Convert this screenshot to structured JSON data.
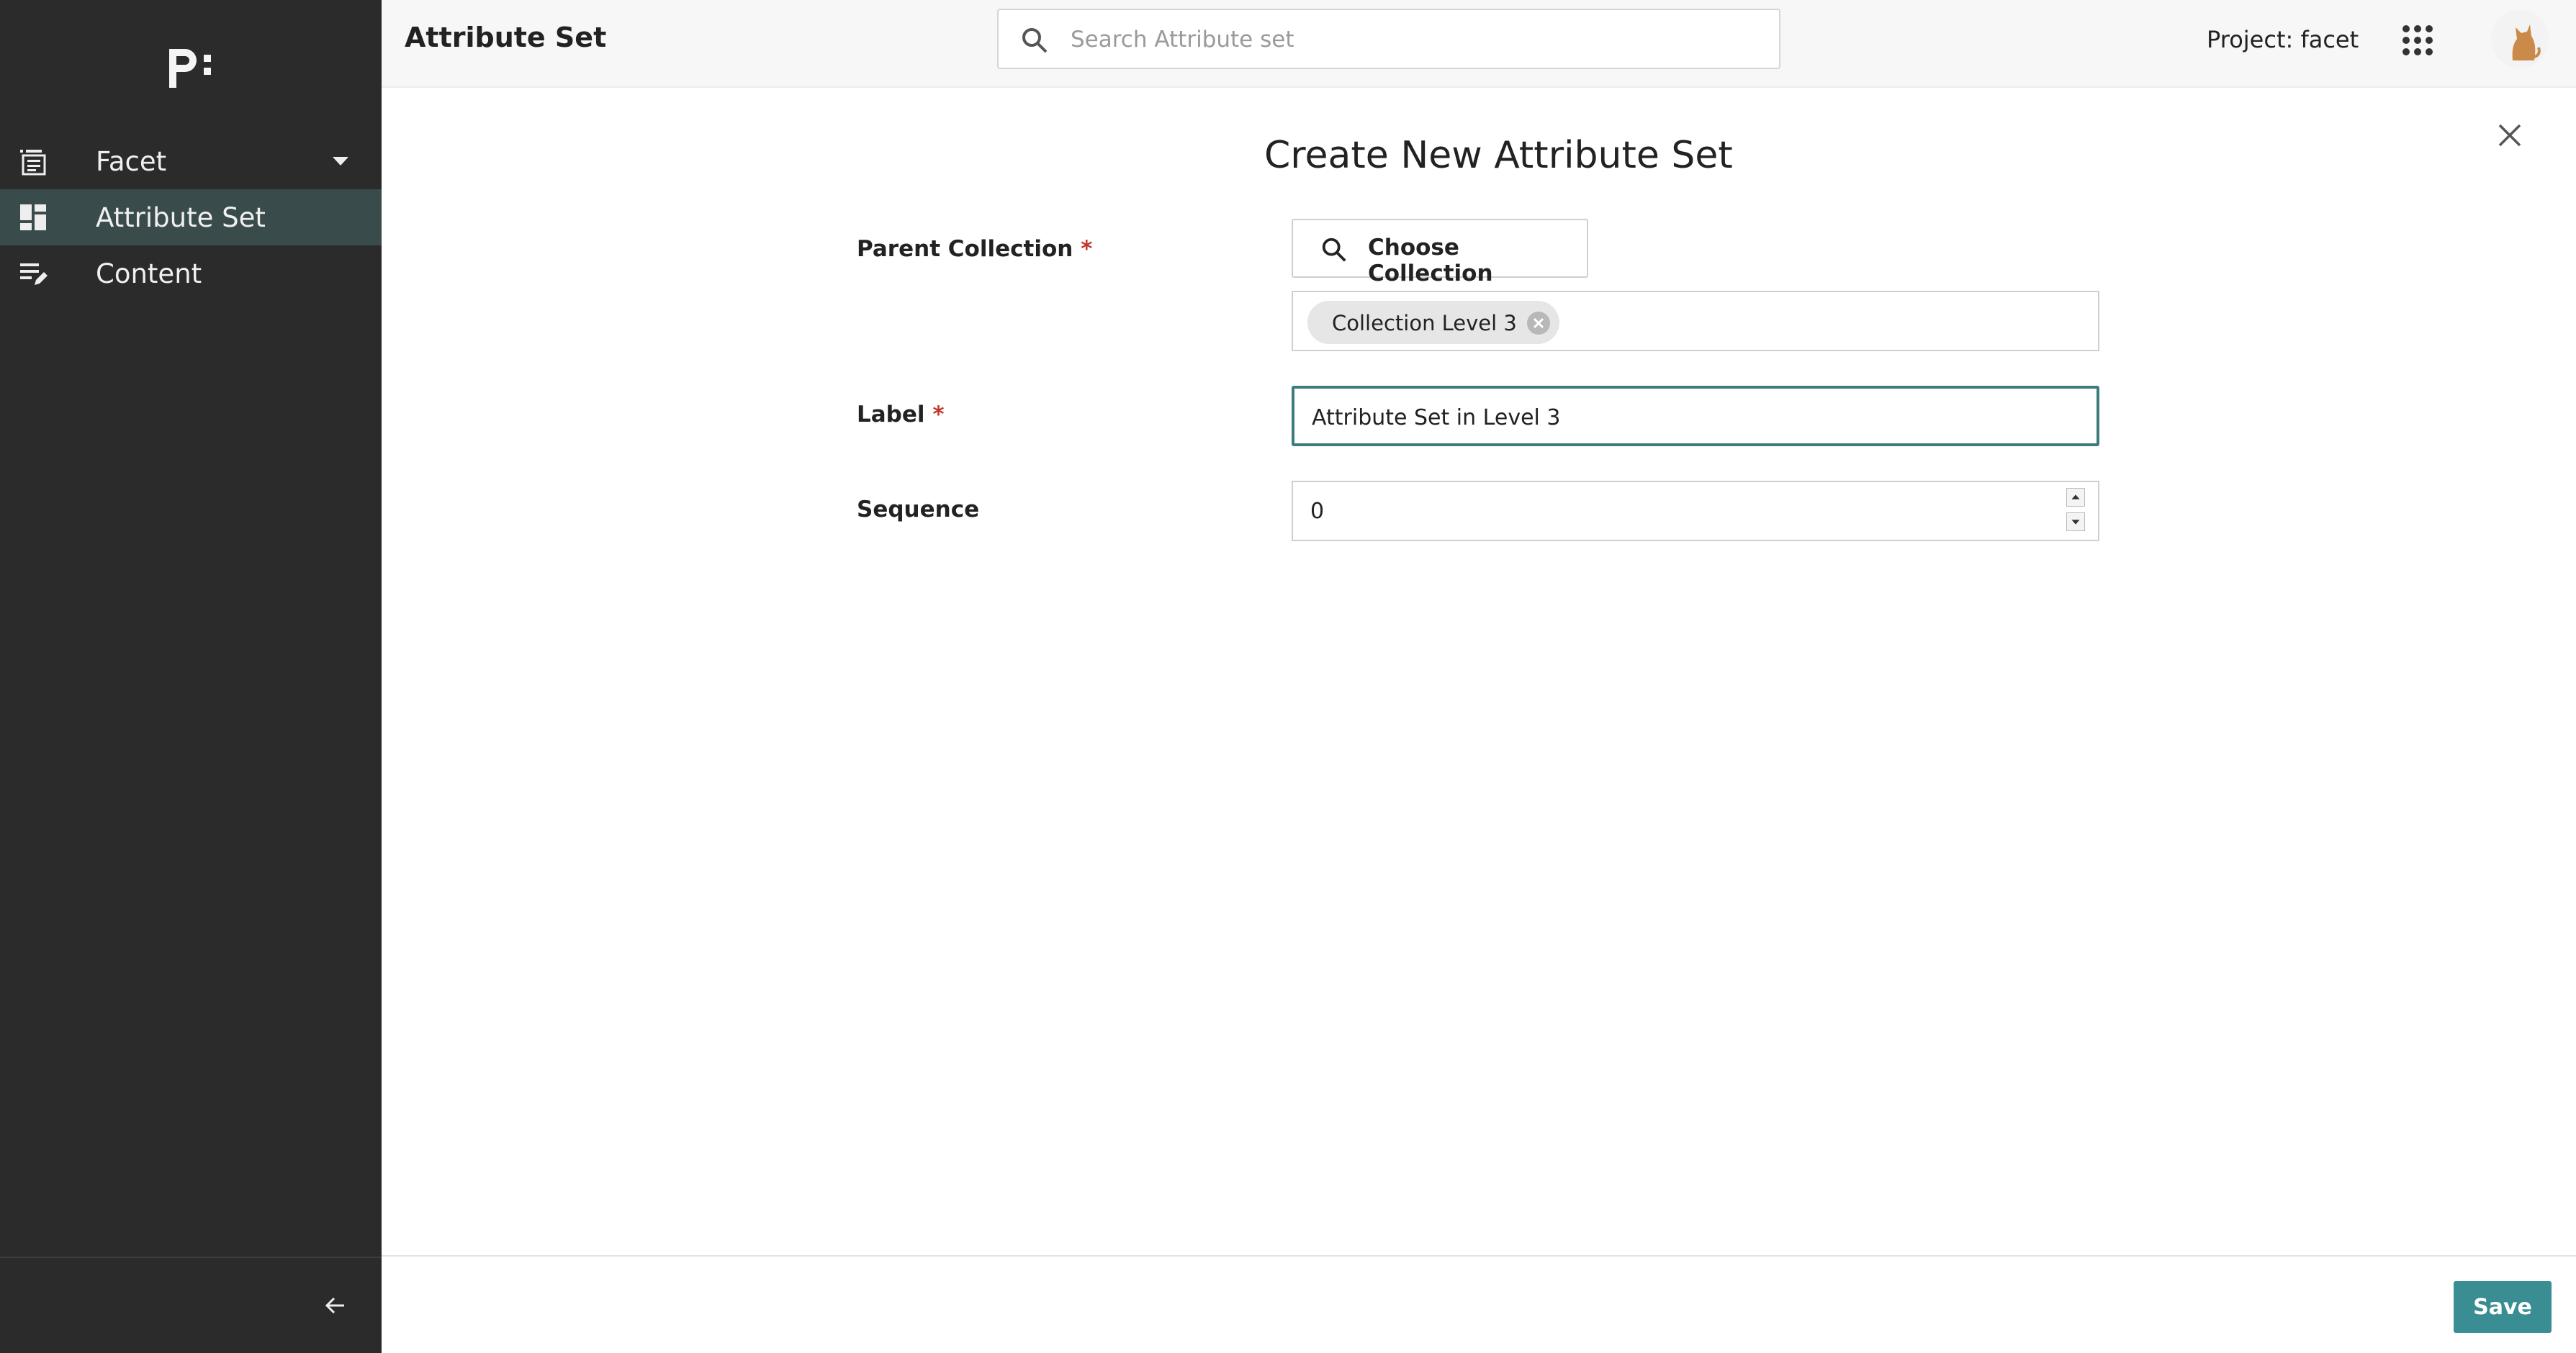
{
  "sidebar": {
    "logo_text": "p:",
    "items": [
      {
        "label": "Facet",
        "icon": "list-icon"
      },
      {
        "label": "Attribute Set",
        "icon": "dashboard-icon"
      },
      {
        "label": "Content",
        "icon": "edit-list-icon"
      }
    ],
    "active_index": 1
  },
  "header": {
    "title": "Attribute Set",
    "search": {
      "placeholder": "Search Attribute set",
      "value": ""
    },
    "project": "Project: facet",
    "apps_icon": "apps-grid-icon",
    "avatar": "cat-avatar"
  },
  "form": {
    "title": "Create New Attribute Set",
    "parent_collection_label": "Parent Collection",
    "required_mark": "*",
    "choose_button": "Choose Collection",
    "selected_chip": "Collection Level 3",
    "label_label": "Label",
    "label_value": "Attribute Set in Level 3",
    "sequence_label": "Sequence",
    "sequence_value": "0"
  },
  "footer": {
    "save_label": "Save"
  },
  "colors": {
    "sidebar_bg": "#2b2b2b",
    "active_item_bg": "#3a4b4b",
    "accent": "#3a8d93",
    "required": "#c0392b"
  }
}
